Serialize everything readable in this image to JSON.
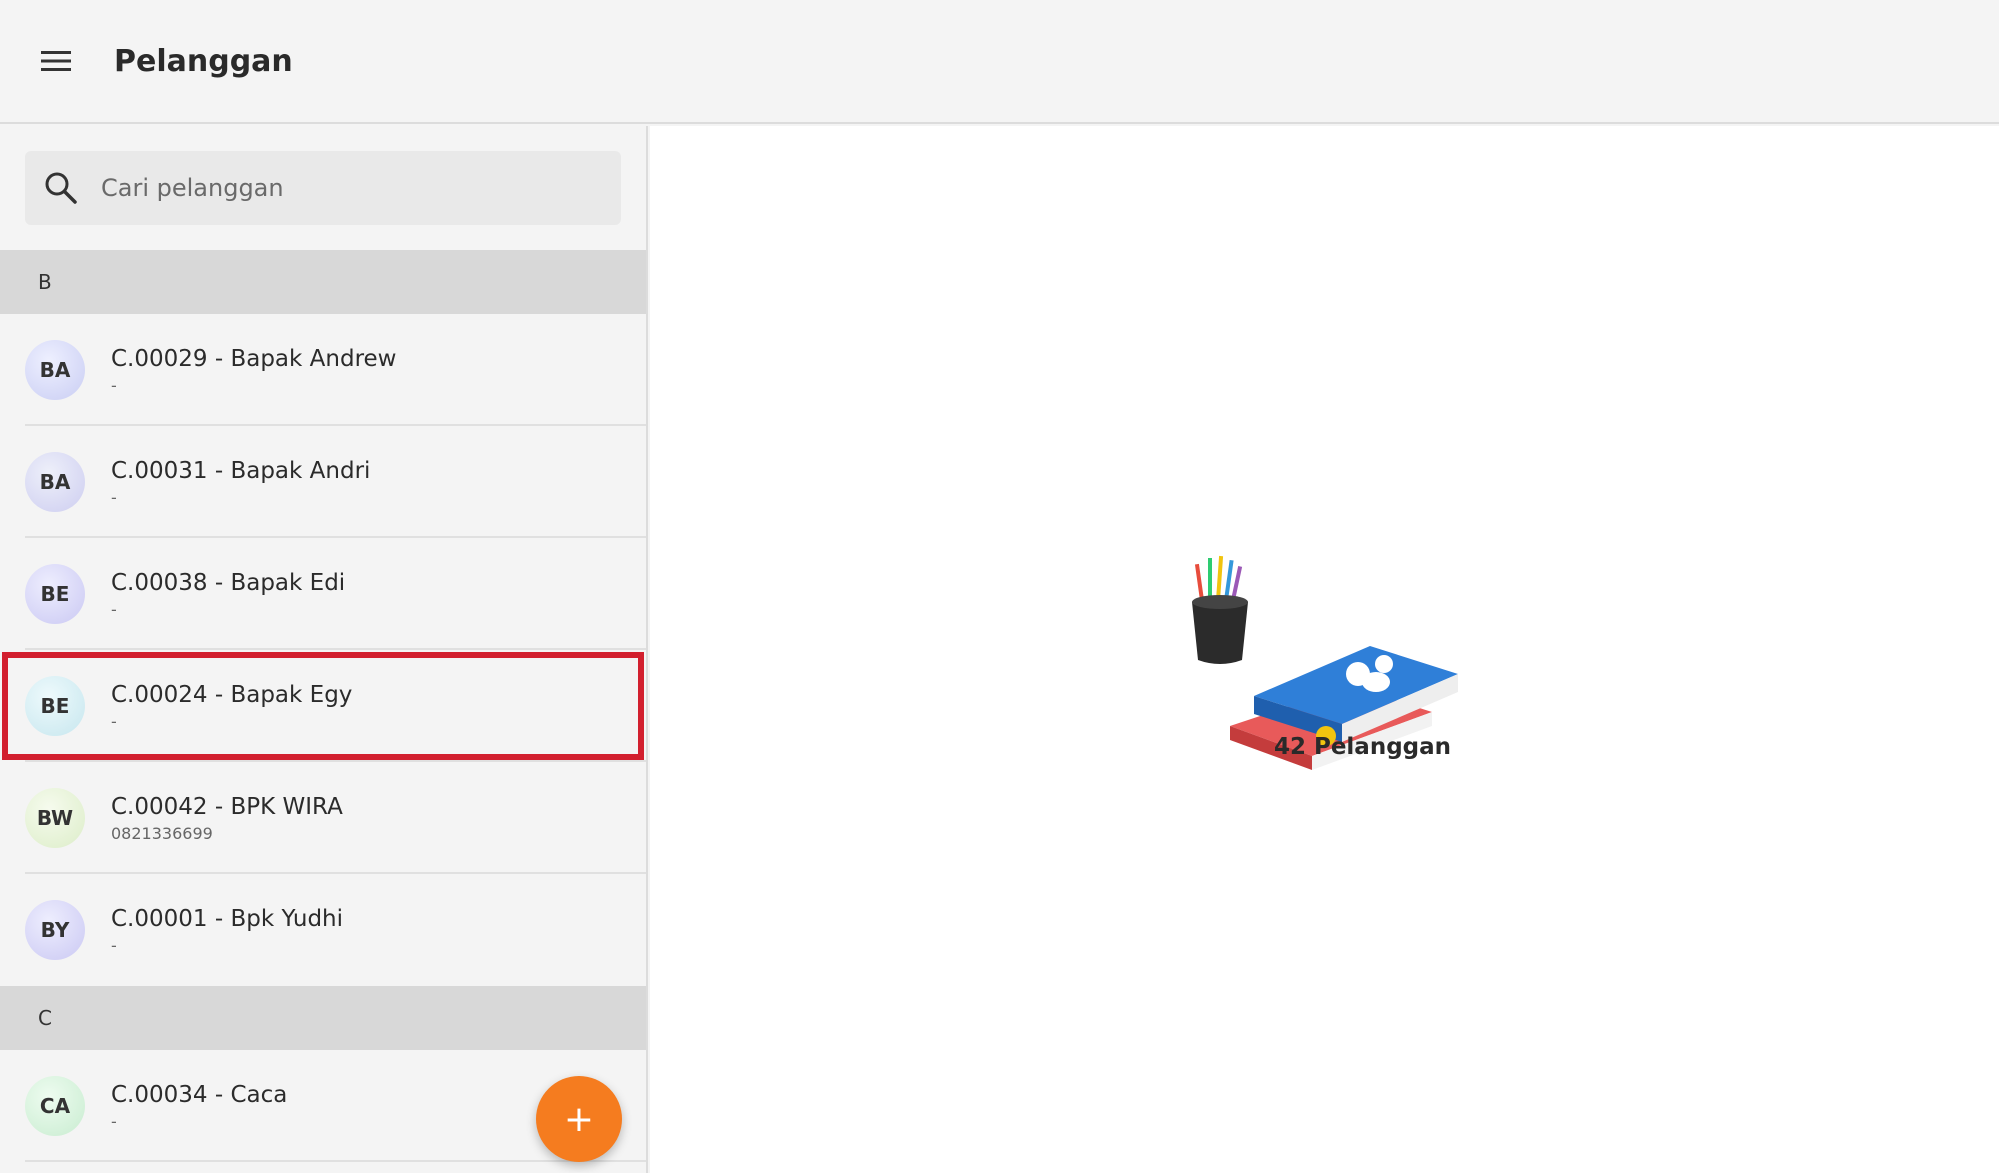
{
  "appbar": {
    "title": "Pelanggan"
  },
  "search": {
    "placeholder": "Cari pelanggan"
  },
  "sections": [
    {
      "letter": "B",
      "items": [
        {
          "initials": "BA",
          "title": "C.00029 - Bapak Andrew",
          "subtitle": "-",
          "avatar_color": "#d9dcf7"
        },
        {
          "initials": "BA",
          "title": "C.00031 - Bapak Andri",
          "subtitle": "-",
          "avatar_color": "#dcdcf5"
        },
        {
          "initials": "BE",
          "title": "C.00038 - Bapak Edi",
          "subtitle": "-",
          "avatar_color": "#dcdaf7"
        },
        {
          "initials": "BE",
          "title": "C.00024 - Bapak Egy",
          "subtitle": "-",
          "avatar_color": "#d7eff4"
        },
        {
          "initials": "BW",
          "title": "C.00042 - BPK WIRA",
          "subtitle": "0821336699",
          "avatar_color": "#e8f4dc"
        },
        {
          "initials": "BY",
          "title": "C.00001 - Bpk Yudhi",
          "subtitle": "-",
          "avatar_color": "#dcdaf7"
        }
      ]
    },
    {
      "letter": "C",
      "items": [
        {
          "initials": "CA",
          "title": "C.00034 - Caca",
          "subtitle": "-",
          "avatar_color": "#dcf4e0"
        }
      ]
    }
  ],
  "fab": {
    "label": "+"
  },
  "summary": {
    "count_label": "42 Pelanggan"
  },
  "colors": {
    "selected_outline": "#d21f2e",
    "fab": "#f57c1f"
  }
}
